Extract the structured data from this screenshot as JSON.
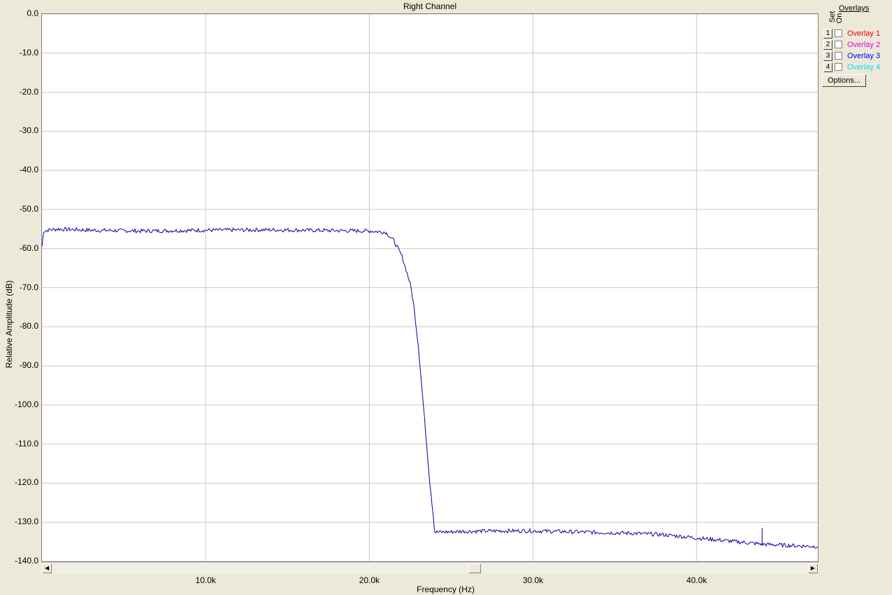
{
  "window": {
    "title": "Right Channel"
  },
  "chart_data": {
    "type": "line",
    "title": "Right Channel",
    "xlabel": "Frequency (Hz)",
    "ylabel": "Relative Amplitude (dB)",
    "xlim": [
      0,
      47400
    ],
    "ylim": [
      -140,
      0
    ],
    "grid": true,
    "y_ticks": [
      "0.0",
      "-10.0",
      "-20.0",
      "-30.0",
      "-40.0",
      "-50.0",
      "-60.0",
      "-70.0",
      "-80.0",
      "-90.0",
      "-100.0",
      "-110.0",
      "-120.0",
      "-130.0",
      "-140.0"
    ],
    "x_ticks": [
      "10.0k",
      "20.0k",
      "30.0k",
      "40.0k"
    ],
    "x_tick_values": [
      10000,
      20000,
      30000,
      40000
    ],
    "line_color": "#0000a0",
    "series": [
      {
        "x": [
          0,
          100,
          500,
          1000,
          3000,
          6000,
          10000,
          14000,
          18000,
          20000,
          21000,
          21500,
          22000,
          22500,
          22700,
          23000,
          23300,
          23500,
          23700,
          23900,
          24000,
          24500,
          26000,
          28000,
          30000,
          32000,
          34000,
          36000,
          38000,
          40000,
          42000,
          43000,
          44000,
          45000,
          46000,
          47400
        ],
        "y": [
          -59.5,
          -55.5,
          -55.2,
          -55.0,
          -55.3,
          -55.5,
          -55.3,
          -55.2,
          -55.4,
          -55.5,
          -55.8,
          -58.0,
          -62.0,
          -69.0,
          -74.0,
          -85.0,
          -100.0,
          -110.0,
          -120.0,
          -128.0,
          -132.5,
          -132.5,
          -132.3,
          -132.2,
          -132.2,
          -132.4,
          -132.6,
          -132.8,
          -133.2,
          -134.0,
          -134.8,
          -135.2,
          -135.6,
          -135.8,
          -136.0,
          -136.2
        ]
      }
    ],
    "spike": {
      "x": 44000,
      "y": -131.5
    }
  },
  "overlays": {
    "title": "Overlays",
    "set_label": "Set",
    "on_label": "On",
    "items": [
      {
        "num": "1",
        "label": "Overlay 1",
        "color": "#ff0000"
      },
      {
        "num": "2",
        "label": "Overlay 2",
        "color": "#e000e0"
      },
      {
        "num": "3",
        "label": "Overlay 3",
        "color": "#0000ff"
      },
      {
        "num": "4",
        "label": "Overlay 4",
        "color": "#00e0ff"
      }
    ],
    "options_label": "Options..."
  },
  "scrollbar": {
    "left_arrow": "◀",
    "right_arrow": "▶"
  }
}
